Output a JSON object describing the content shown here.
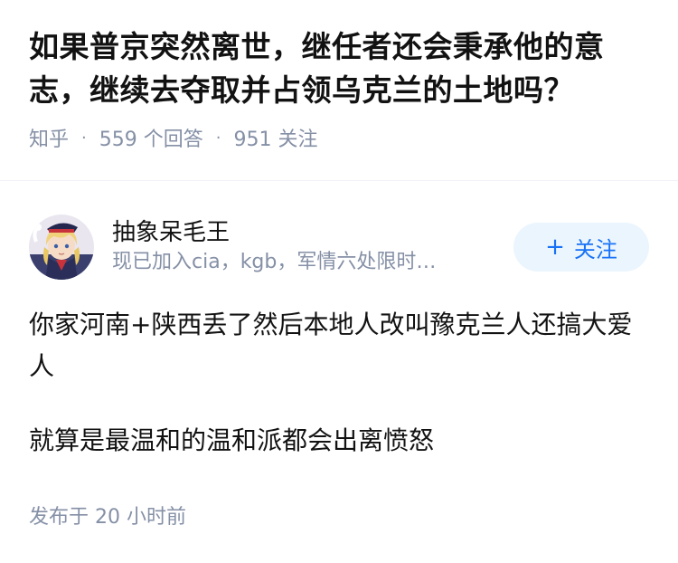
{
  "question": {
    "title": "如果普京突然离世，继任者还会秉承他的意志，继续去夺取并占领乌克兰的土地吗？",
    "source": "知乎",
    "answers_count": "559 个回答",
    "followers_count": "951 关注",
    "separator": "·"
  },
  "answer": {
    "author": {
      "name": "抽象呆毛王",
      "bio": "现已加入cia，kgb，军情六处限时…",
      "avatar_icon": "anime-character-avatar"
    },
    "follow_button": {
      "plus": "+",
      "label": "关注"
    },
    "paragraphs": [
      "你家河南+陕西丢了然后本地人改叫豫克兰人还搞大爱人",
      "就算是最温和的温和派都会出离愤怒"
    ],
    "published": "发布于 20 小时前"
  },
  "colors": {
    "title": "#121212",
    "meta": "#8590a6",
    "follow_bg": "#ebf5fe",
    "follow_text": "#1772f6"
  }
}
